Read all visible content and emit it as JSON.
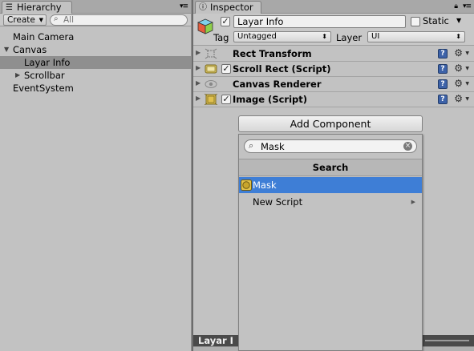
{
  "hierarchy": {
    "tab_label": "Hierarchy",
    "create_label": "Create",
    "search_placeholder": "All",
    "items": [
      {
        "label": "Main Camera"
      },
      {
        "label": "Canvas"
      },
      {
        "label": "Layar Info"
      },
      {
        "label": "Scrollbar"
      },
      {
        "label": "EventSystem"
      }
    ]
  },
  "inspector": {
    "tab_label": "Inspector",
    "object_name": "Layar Info",
    "static_label": "Static",
    "tag_label": "Tag",
    "tag_value": "Untagged",
    "layer_label": "Layer",
    "layer_value": "UI",
    "components": [
      {
        "name": "Rect Transform"
      },
      {
        "name": "Scroll Rect (Script)"
      },
      {
        "name": "Canvas Renderer"
      },
      {
        "name": "Image (Script)"
      }
    ],
    "add_component_label": "Add Component"
  },
  "add_component_popup": {
    "search_value": "Mask",
    "header": "Search",
    "items": [
      {
        "label": "Mask"
      },
      {
        "label": "New Script"
      }
    ]
  },
  "preview": {
    "label": "Layar I"
  },
  "colors": {
    "selection_blue": "#3e7ed6",
    "panel_gray": "#c2c2c2",
    "hierarchy_selected": "#8f8f8f"
  }
}
